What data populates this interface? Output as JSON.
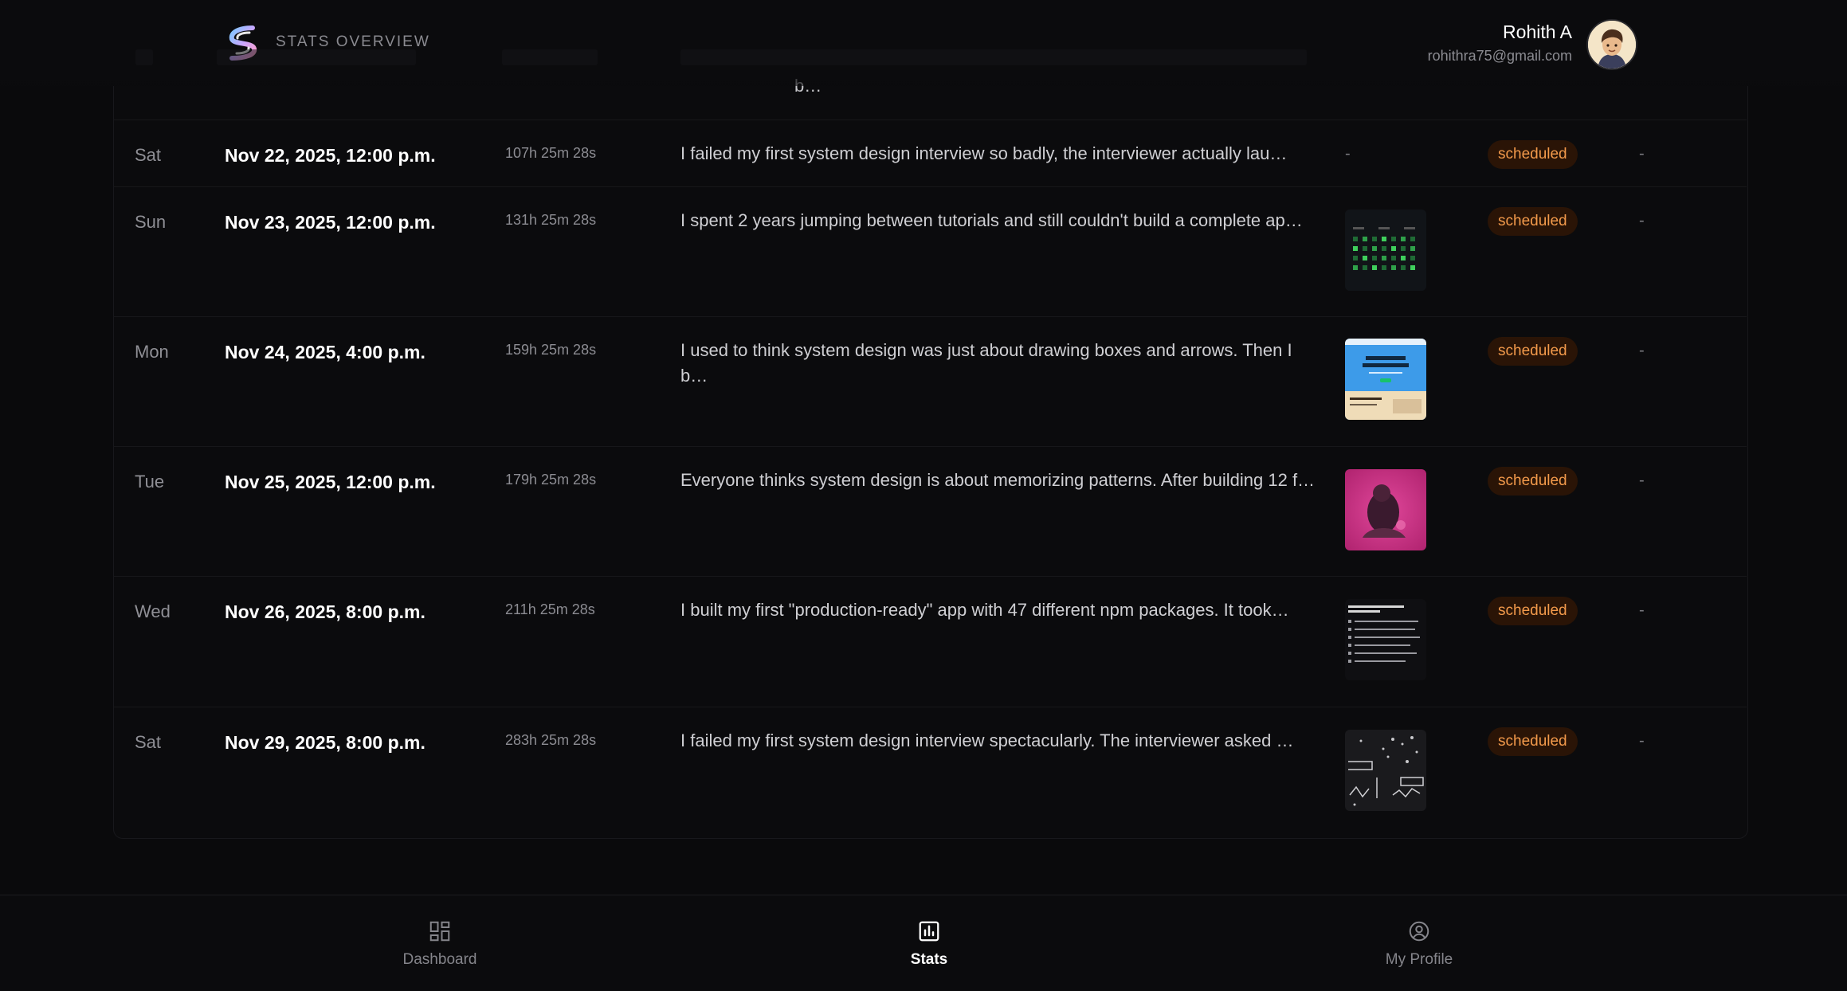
{
  "header": {
    "title": "STATS OVERVIEW",
    "user_name": "Rohith A",
    "user_email": "rohithra75@gmail.com"
  },
  "clipped_row": {
    "content_tail": "b…"
  },
  "rows": [
    {
      "day": "Sat",
      "date": "Nov 22, 2025, 12:00 p.m.",
      "countdown": "107h 25m 28s",
      "content": "I failed my first system design interview so badly, the interviewer actually lau…",
      "media": "-",
      "status": "scheduled",
      "extra": "-"
    },
    {
      "day": "Sun",
      "date": "Nov 23, 2025, 12:00 p.m.",
      "countdown": "131h 25m 28s",
      "content": "I spent 2 years jumping between tutorials and still couldn't build a complete ap…",
      "media": "contribution-graph",
      "status": "scheduled",
      "extra": "-"
    },
    {
      "day": "Mon",
      "date": "Nov 24, 2025, 4:00 p.m.",
      "countdown": "159h 25m 28s",
      "content": "I used to think system design was just about drawing boxes and arrows. Then I b…",
      "media": "website-promo",
      "status": "scheduled",
      "extra": "-"
    },
    {
      "day": "Tue",
      "date": "Nov 25, 2025, 12:00 p.m.",
      "countdown": "179h 25m 28s",
      "content": "Everyone thinks system design is about memorizing patterns. After building 12 f…",
      "media": "pink-photo",
      "status": "scheduled",
      "extra": "-"
    },
    {
      "day": "Wed",
      "date": "Nov 26, 2025, 8:00 p.m.",
      "countdown": "211h 25m 28s",
      "content": "I built my first \"production-ready\" app with 47 different npm packages. It took…",
      "media": "text-list",
      "status": "scheduled",
      "extra": "-"
    },
    {
      "day": "Sat",
      "date": "Nov 29, 2025, 8:00 p.m.",
      "countdown": "283h 25m 28s",
      "content": "I failed my first system design interview spectacularly. The interviewer asked …",
      "media": "diagram-dark",
      "status": "scheduled",
      "extra": "-"
    }
  ],
  "nav": [
    {
      "label": "Dashboard",
      "icon": "dashboard-icon",
      "active": false
    },
    {
      "label": "Stats",
      "icon": "bar-chart-icon",
      "active": true
    },
    {
      "label": "My Profile",
      "icon": "user-circle-icon",
      "active": false
    }
  ],
  "colors": {
    "badge_text": "#f39a4b",
    "badge_bg": "#2a1406",
    "background": "#0a0a0c"
  }
}
